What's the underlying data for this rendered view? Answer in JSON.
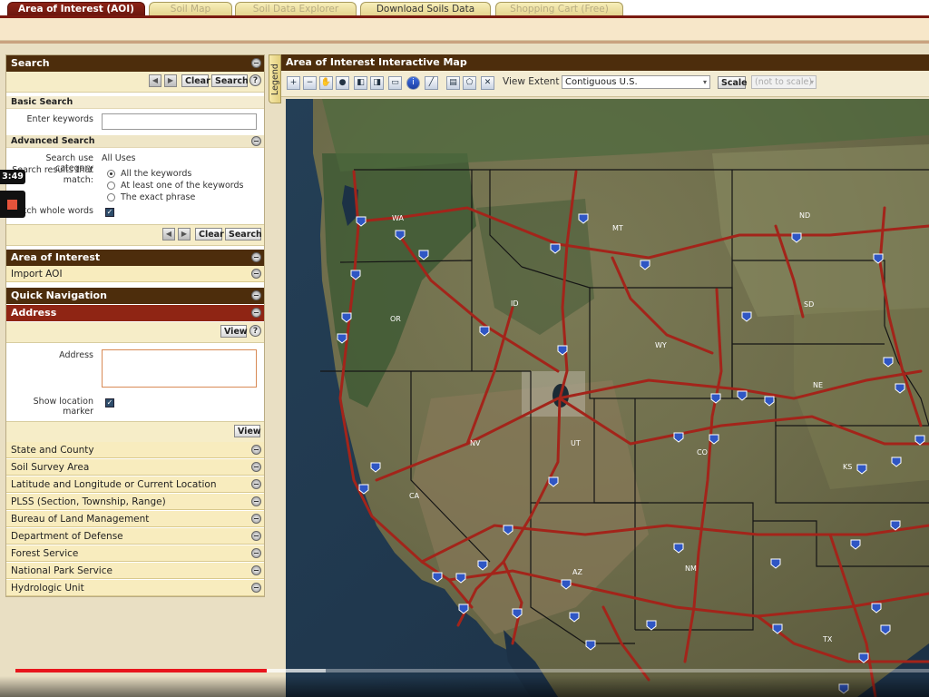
{
  "tabs": [
    {
      "label": "Area of Interest (AOI)",
      "active": true
    },
    {
      "label": "Soil Map",
      "active": false
    },
    {
      "label": "Soil Data Explorer",
      "active": false
    },
    {
      "label": "Download Soils Data",
      "active": false
    },
    {
      "label": "Shopping Cart (Free)",
      "active": false
    }
  ],
  "search": {
    "title": "Search",
    "clear_label": "Clear",
    "search_label": "Search",
    "help_label": "?",
    "basic_search_title": "Basic Search",
    "keywords_label": "Enter keywords",
    "keywords_value": "",
    "advanced_title": "Advanced Search",
    "use_category_label": "Search use category",
    "use_category_value": "All Uses",
    "match_label_line1": "Search results that",
    "match_label_line2": "match:",
    "match_options": [
      "All the keywords",
      "At least one of the keywords",
      "The exact phrase"
    ],
    "match_whole_words_label": "Match whole words"
  },
  "aoi": {
    "title": "Area of Interest",
    "import_label": "Import AOI"
  },
  "quick_nav": {
    "title": "Quick Navigation",
    "address_title": "Address",
    "view_label": "View",
    "address_label": "Address",
    "address_value": "",
    "show_marker_line1": "Show location",
    "show_marker_line2": "marker",
    "items": [
      "State and County",
      "Soil Survey Area",
      "Latitude and Longitude or Current Location",
      "PLSS (Section, Township, Range)",
      "Bureau of Land Management",
      "Department of Defense",
      "Forest Service",
      "National Park Service",
      "Hydrologic Unit"
    ]
  },
  "map": {
    "legend_label": "Legend",
    "title": "Area of Interest Interactive Map",
    "view_extent_label": "View Extent",
    "view_extent_value": "Contiguous U.S.",
    "scale_label": "Scale",
    "scale_value": "(not to scale)",
    "state_labels": [
      "WA",
      "OR",
      "ID",
      "MT",
      "ND",
      "SD",
      "WY",
      "NE",
      "NV",
      "UT",
      "CO",
      "KS",
      "CA",
      "AZ",
      "NM",
      "TX"
    ],
    "road_color": "#a3241a",
    "shield_color": "#2f56c4",
    "state_line_color": "#1a1a1a"
  },
  "video": {
    "time": "3:49",
    "progress": 0.275,
    "buffered": 0.34,
    "progress_color": "#e8161c"
  }
}
